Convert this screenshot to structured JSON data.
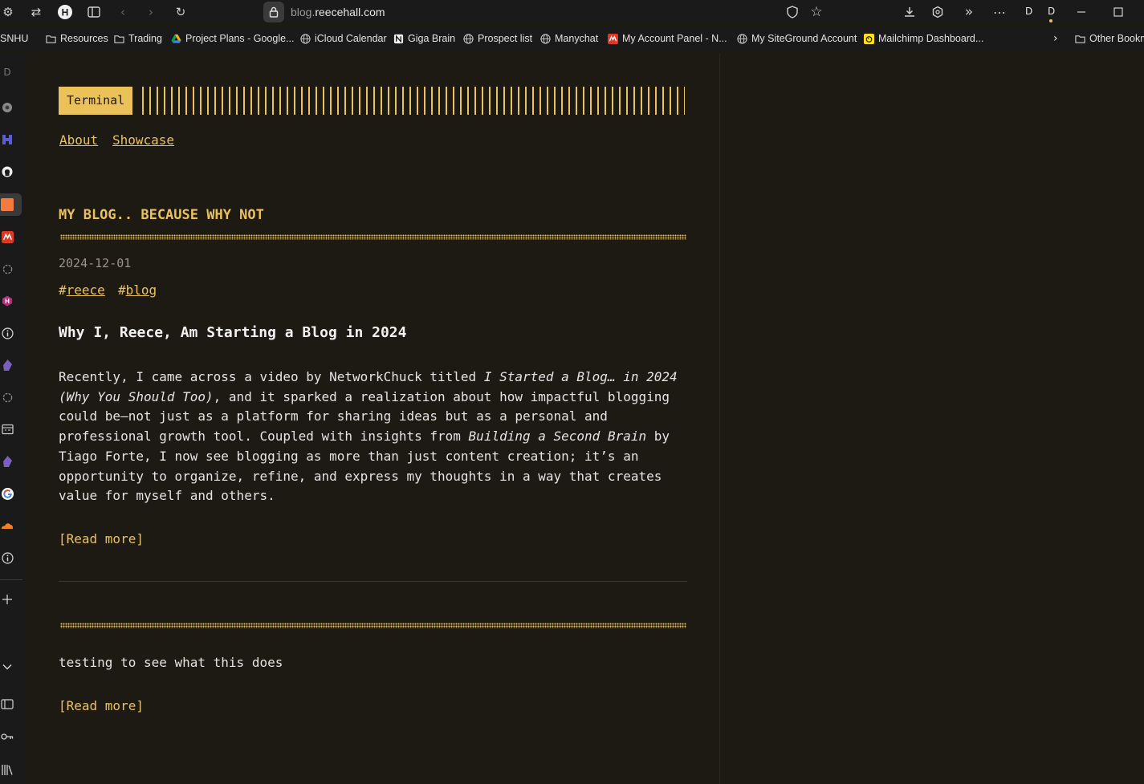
{
  "browser": {
    "url_prefix": "blog.",
    "url_host": "reecehall.com",
    "profile_letters": [
      "D",
      "D"
    ]
  },
  "bookmarks": [
    {
      "label": "SNHU",
      "icon": "folder-icon"
    },
    {
      "label": "Resources",
      "icon": "folder-icon"
    },
    {
      "label": "Trading",
      "icon": "folder-icon"
    },
    {
      "label": "Project Plans - Google...",
      "icon": "google-drive-icon"
    },
    {
      "label": "iCloud Calendar",
      "icon": "globe-icon"
    },
    {
      "label": "Giga Brain",
      "icon": "notion-icon"
    },
    {
      "label": "Prospect list",
      "icon": "globe-icon"
    },
    {
      "label": "Manychat",
      "icon": "globe-icon"
    },
    {
      "label": "My Account Panel - N...",
      "icon": "namecheap-icon"
    },
    {
      "label": "My SiteGround Account",
      "icon": "globe-icon"
    },
    {
      "label": "Mailchimp Dashboard...",
      "icon": "mailchimp-icon"
    },
    {
      "label": "Other Bookm",
      "icon": "folder-icon"
    }
  ],
  "site": {
    "logo": "Terminal",
    "nav": [
      "About",
      "Showcase"
    ]
  },
  "posts": [
    {
      "title": "MY BLOG.. BECAUSE WHY NOT",
      "date": "2024-12-01",
      "tags": [
        "reece",
        "blog"
      ],
      "heading": "Why I, Reece, Am Starting a Blog in 2024",
      "p_a": "Recently, I came across a video by NetworkChuck titled ",
      "p_b": "I Started a Blog… in 2024 (Why You Should Too)",
      "p_c": ", and it sparked a realization about how impactful blogging could be—not just as a platform for sharing ideas but as a personal and professional growth tool. Coupled with insights from ",
      "p_d": "Building a Second Brain",
      "p_e": " by Tiago Forte, I now see blogging as more than just content creation; it’s an opportunity to organize, refine, and express my thoughts in a way that creates value for myself and others.",
      "read_more": "[Read more]"
    },
    {
      "text": "testing to see what this does",
      "read_more": "[Read more]"
    }
  ],
  "colors": {
    "accent": "#ebc15a",
    "background": "#1d1a13",
    "chrome": "#1a1a1a"
  }
}
